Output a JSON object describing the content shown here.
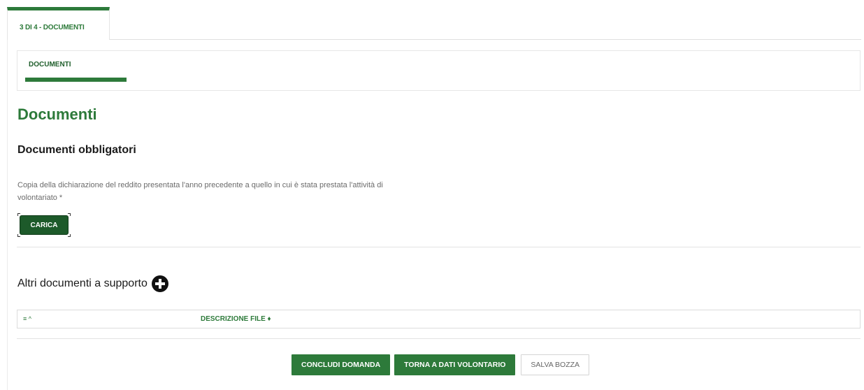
{
  "step_tab": {
    "label": "3 DI 4 - DOCUMENTI"
  },
  "subtab": {
    "label": "DOCUMENTI"
  },
  "page_title": "Documenti",
  "required_docs": {
    "heading": "Documenti obbligatori",
    "description": "Copia della dichiarazione del reddito presentata l'anno precedente a quello in cui è stata prestata l'attività di volontariato *",
    "upload_label": "CARICA"
  },
  "other_docs": {
    "heading": "Altri documenti a supporto",
    "add_icon": "plus-circle-icon",
    "table": {
      "sort_col": "≡ ^",
      "desc_col": "DESCRIZIONE FILE ♦"
    }
  },
  "actions": {
    "conclude": "CONCLUDI DOMANDA",
    "back": "TORNA A DATI VOLONTARIO",
    "save_draft": "SALVA BOZZA"
  },
  "colors": {
    "accent": "#2d7a3a",
    "dark_button": "#1d5a2a"
  }
}
